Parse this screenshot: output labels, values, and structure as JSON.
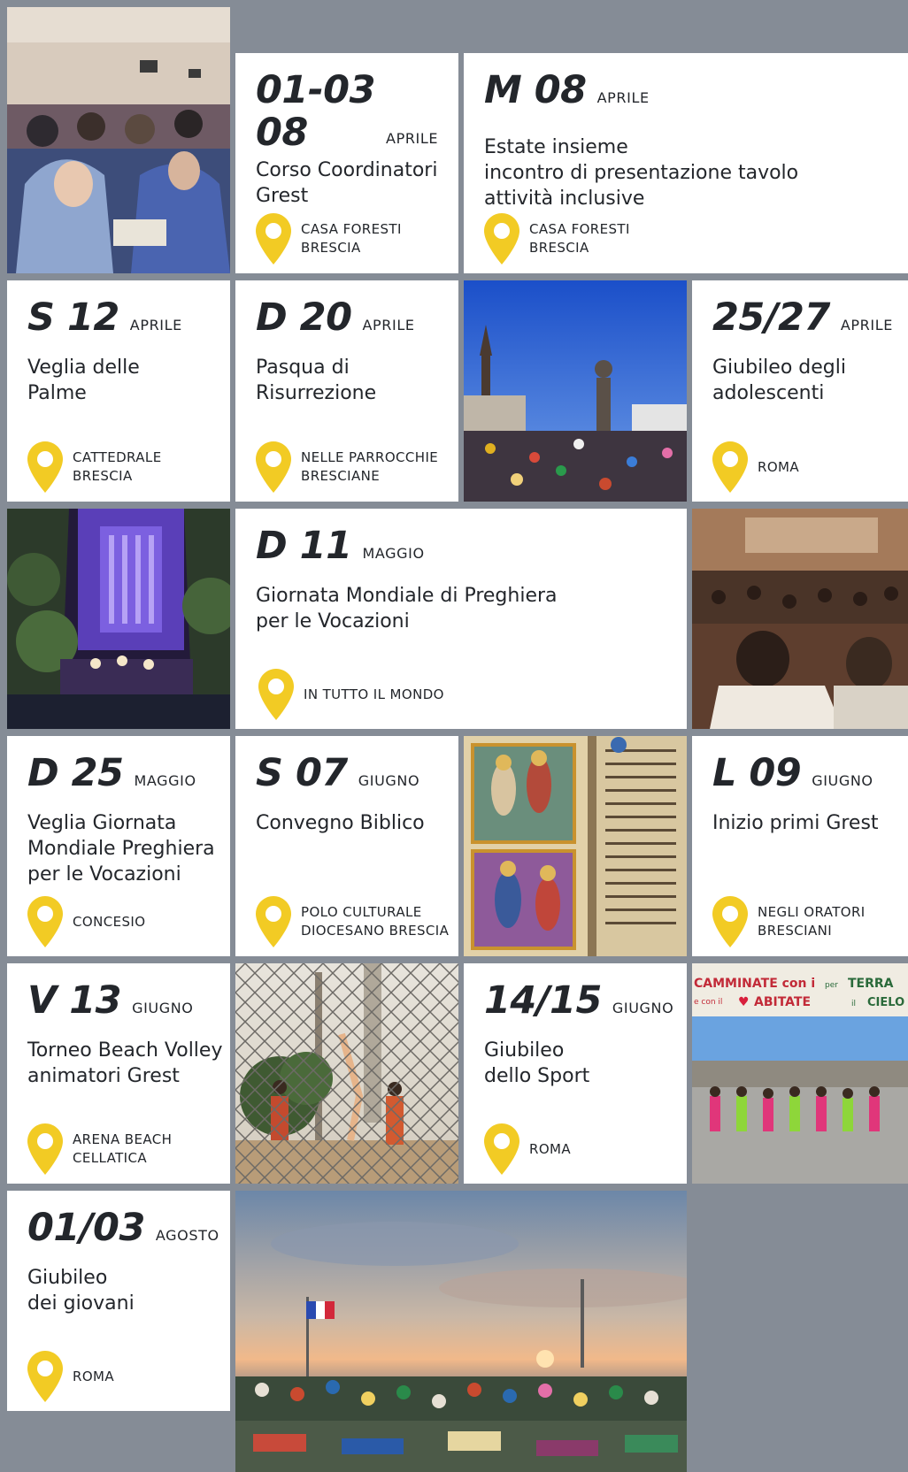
{
  "colors": {
    "page_background": "#858c96",
    "pin_yellow": "#f2cb24",
    "text": "#23262b"
  },
  "pin_icon": "map-pin-icon",
  "events": [
    {
      "day": "01-03\n08",
      "month": "APRILE",
      "title": "Corso Coordinatori\nGrest",
      "location": "CASA FORESTI\nBRESCIA"
    },
    {
      "day": "M 08",
      "month": "APRILE",
      "title": "Estate insieme\nincontro di presentazione tavolo\nattività inclusive",
      "location": "CASA FORESTI\nBRESCIA"
    },
    {
      "day": "S 12",
      "month": "APRILE",
      "title": "Veglia delle\nPalme",
      "location": "CATTEDRALE\nBRESCIA"
    },
    {
      "day": "D 20",
      "month": "APRILE",
      "title": "Pasqua di\nRisurrezione",
      "location": "NELLE PARROCCHIE\nBRESCIANE"
    },
    {
      "day": "25/27",
      "month": "APRILE",
      "title": "Giubileo degli\nadolescenti",
      "location": "ROMA"
    },
    {
      "day": "D 11",
      "month": "MAGGIO",
      "title": "Giornata Mondiale di Preghiera\nper le Vocazioni",
      "location": "IN TUTTO IL MONDO"
    },
    {
      "day": "D 25",
      "month": "MAGGIO",
      "title": "Veglia Giornata\nMondiale Preghiera\nper le Vocazioni",
      "location": "CONCESIO"
    },
    {
      "day": "S 07",
      "month": "GIUGNO",
      "title": "Convegno Biblico",
      "location": "POLO CULTURALE\nDIOCESANO BRESCIA"
    },
    {
      "day": "L 09",
      "month": "GIUGNO",
      "title": "Inizio primi Grest",
      "location": "NEGLI ORATORI\nBRESCIANI"
    },
    {
      "day": "V 13",
      "month": "GIUGNO",
      "title": "Torneo Beach Volley\nanimatori Grest",
      "location": "ARENA BEACH\nCELLATICA"
    },
    {
      "day": "14/15",
      "month": "GIUGNO",
      "title": "Giubileo\ndello Sport",
      "location": "ROMA"
    },
    {
      "day": "01/03",
      "month": "AGOSTO",
      "title": "Giubileo\ndei giovani",
      "location": "ROMA"
    }
  ],
  "photos": {
    "conference": {
      "banner": ""
    },
    "mural": {
      "banner_left": "CAMMINATE con i",
      "banner_mid": "ABITATE",
      "banner_right": "TERRA",
      "banner_small_1": "e con il",
      "banner_small_2": "per",
      "banner_small_3": "il",
      "banner_right_2": "CIELO"
    }
  }
}
